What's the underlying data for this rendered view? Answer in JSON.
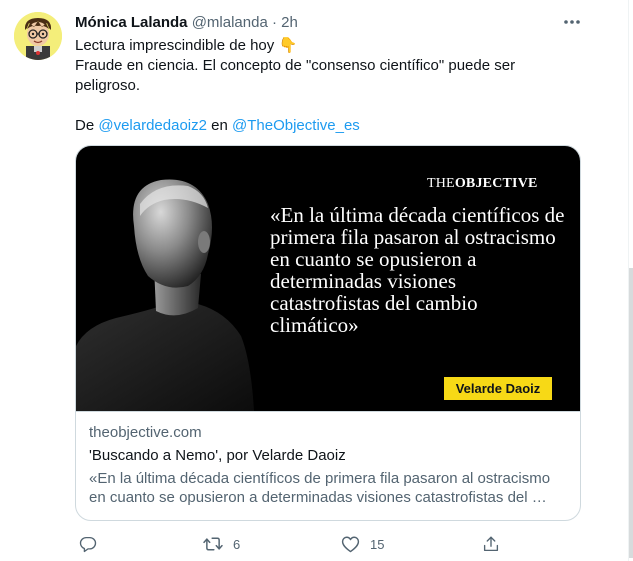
{
  "tweet": {
    "author_name": "Mónica Lalanda",
    "handle": "@mlalanda",
    "separator": "·",
    "time": "2h",
    "text_line1": "Lectura imprescindible de hoy 👇",
    "text_line2": "Fraude en ciencia. El concepto de \"consenso científico\" puede ser peligroso.",
    "byline_prefix": "De ",
    "mention1": "@velardedaoiz2",
    "byline_mid": " en ",
    "mention2": "@TheObjective_es"
  },
  "card": {
    "brand_the": "THE",
    "brand_objective": "OBJECTIVE",
    "quote": "«En la última década científicos de primera fila pasaron al ostracismo en cuanto se opusieron a determinadas visiones catastrofistas del cambio climático»",
    "author_tag": "Velarde Daoiz",
    "domain": "theobjective.com",
    "title": "'Buscando a Nemo', por Velarde Daoiz",
    "description": "«En la última década científicos de primera fila pasaron al ostracismo en cuanto se opusieron a determinadas visiones catastrofistas del …"
  },
  "actions": {
    "retweets": "6",
    "likes": "15"
  },
  "icons": {
    "more": "more-icon",
    "reply": "reply-icon",
    "retweet": "retweet-icon",
    "like": "heart-icon",
    "share": "share-icon"
  },
  "colors": {
    "link": "#1d9bf0",
    "secondary_text": "#536471",
    "author_tag_bg": "#f7d916"
  }
}
